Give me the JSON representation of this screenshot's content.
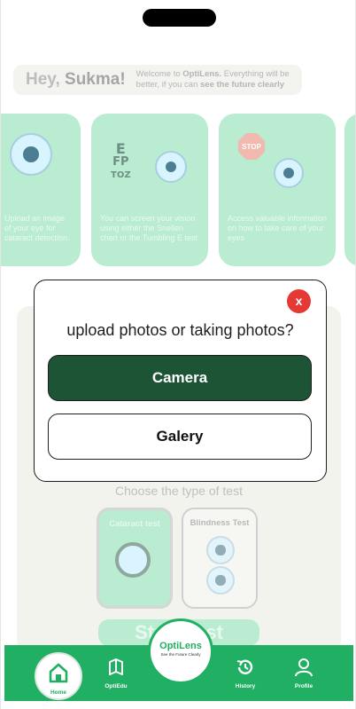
{
  "header": {
    "greeting_prefix": "Hey,",
    "user_name": "Sukma!",
    "welcome_text_1": "Welcome to",
    "app_name": "OptiLens.",
    "welcome_text_2": "Everything will be better, if you can",
    "welcome_emphasis": "see the future clearly"
  },
  "cards": [
    {
      "caption": "Upload an image of your eye for cataract detection."
    },
    {
      "caption": "You can screen your vision using either the Snellen chart or the Tumbling E test"
    },
    {
      "caption": "Access valuable information on how to take care of your eyes"
    }
  ],
  "eye_chart_letters": [
    "E",
    "FP",
    "TOZ"
  ],
  "stop_sign_text": "STOP",
  "test_section": {
    "choose_label": "Choose the type of test",
    "tests": [
      {
        "label": "Cataract test"
      },
      {
        "label": "Blindness Test"
      }
    ],
    "start_label": "Start Test"
  },
  "dialog": {
    "title": "upload photos or taking photos?",
    "close_label": "x",
    "camera_label": "Camera",
    "gallery_label": "Galery"
  },
  "nav": {
    "home": "Home",
    "optiedu": "OptiEdu",
    "brand": "OptiLens",
    "brand_tagline": "See the Future Clearly",
    "history": "History",
    "profile": "Profile"
  },
  "colors": {
    "accent": "#21b063",
    "camera_button": "#1e5436",
    "close_button": "#e53935"
  }
}
